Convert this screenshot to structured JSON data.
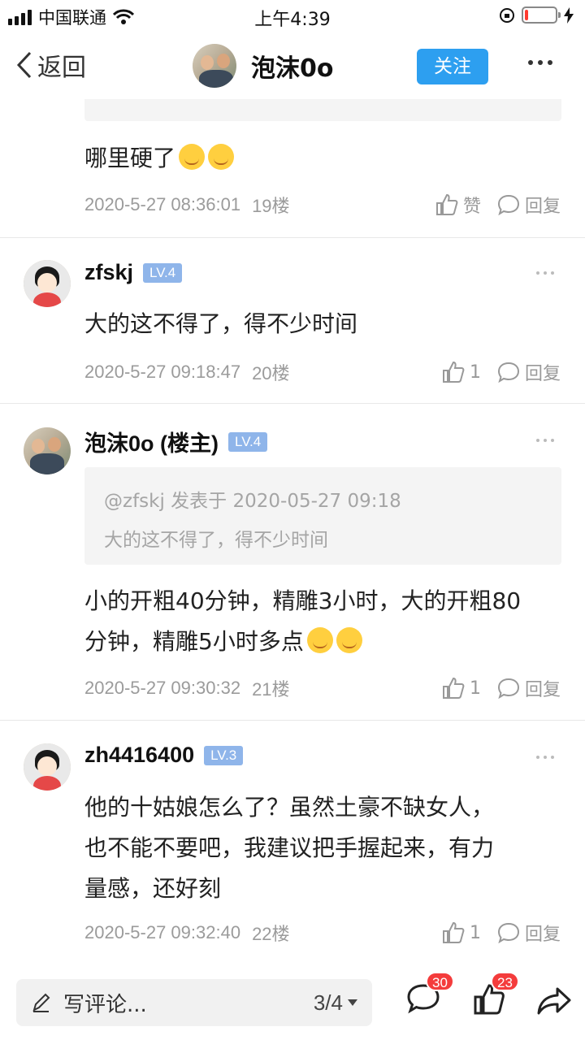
{
  "status_bar": {
    "carrier": "中国联通",
    "time": "上午4:39",
    "battery_level": 0.12,
    "battery_color": "#ff3b30"
  },
  "nav": {
    "back_label": "返回",
    "title": "泡沫0o",
    "follow_label": "关注",
    "accent_color": "#2d9ff0"
  },
  "posts": [
    {
      "body": "哪里硬了",
      "emojis": 2,
      "date": "2020-5-27 08:36:01",
      "floor": "19楼",
      "like_label": "赞",
      "reply_label": "回复"
    },
    {
      "username": "zfskj",
      "level": "LV.4",
      "body": "大的这不得了，得不少时间",
      "date": "2020-5-27 09:18:47",
      "floor": "20楼",
      "like_count": "1",
      "reply_label": "回复"
    },
    {
      "username": "泡沫0o (楼主)",
      "level": "LV.4",
      "quote_header": "@zfskj 发表于 2020-05-27 09:18",
      "quote_body": "大的这不得了，得不少时间",
      "body_line1": "小的开粗40分钟，精雕3小时，大的开粗80",
      "body_line2": "分钟，精雕5小时多点",
      "emojis": 2,
      "date": "2020-5-27 09:30:32",
      "floor": "21楼",
      "like_count": "1",
      "reply_label": "回复"
    },
    {
      "username": "zh4416400",
      "level": "LV.3",
      "body_line1": "他的十姑娘怎么了？虽然土豪不缺女人，",
      "body_line2": "也不能不要吧，我建议把手握起来，有力",
      "body_line3": "量感，还好刻",
      "date": "2020-5-27 09:32:40",
      "floor": "22楼",
      "like_count": "1",
      "reply_label": "回复"
    }
  ],
  "bottom_bar": {
    "comment_placeholder": "写评论...",
    "pager": "3/4",
    "comment_badge": "30",
    "like_badge": "23"
  }
}
